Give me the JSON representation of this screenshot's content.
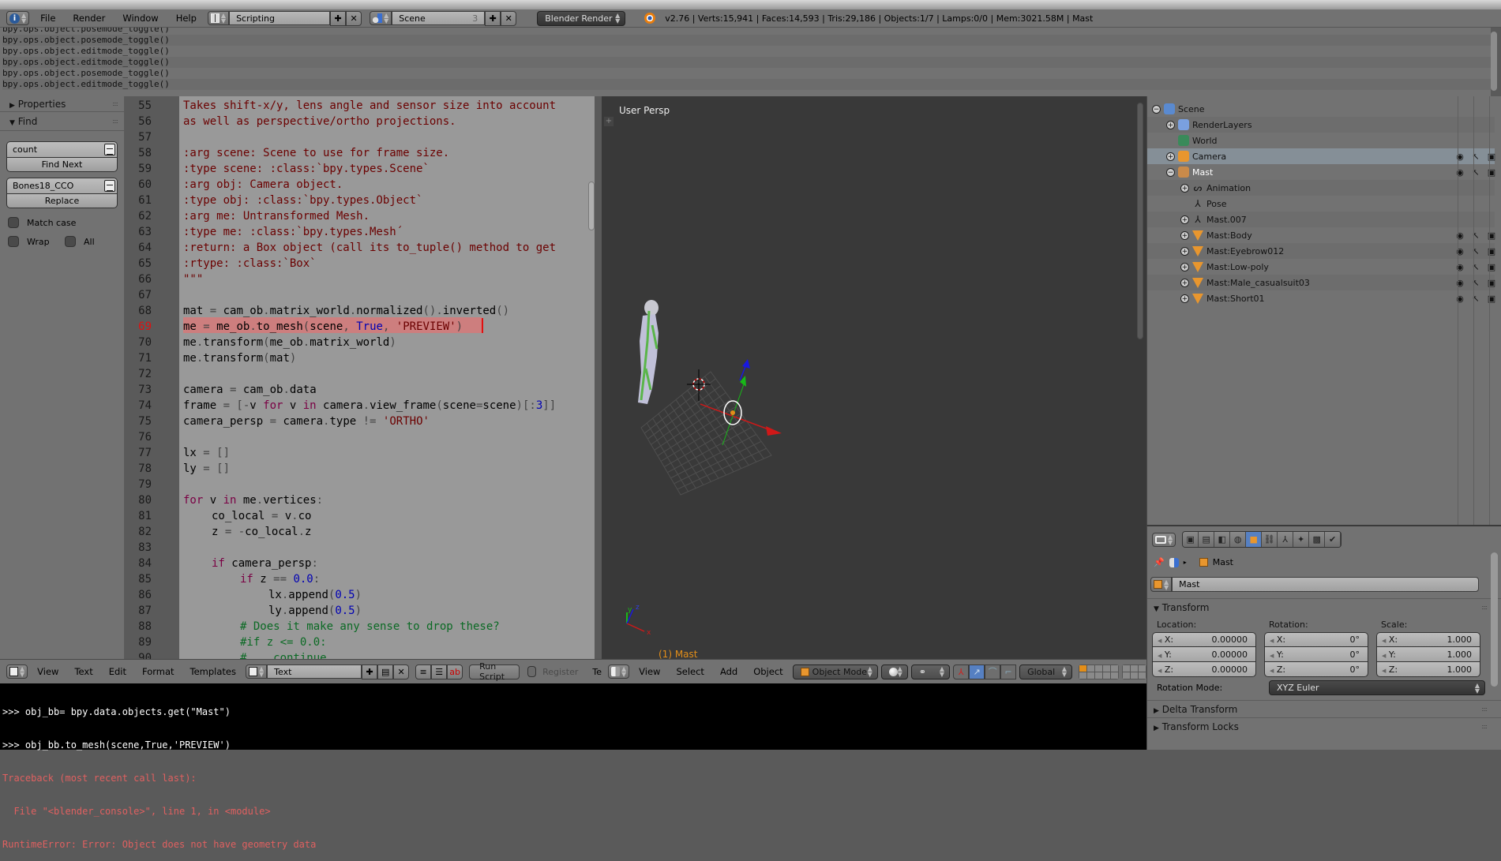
{
  "topbar": {
    "menus": [
      "File",
      "Render",
      "Window",
      "Help"
    ],
    "screen_layout": "Scripting",
    "scene": "Scene",
    "scene_users": "3",
    "render_engine": "Blender Render",
    "stats": "v2.76 | Verts:15,941 | Faces:14,593 | Tris:29,186 | Objects:1/7 | Lamps:0/0 | Mem:3021.58M | Mast"
  },
  "info_log": [
    "bpy.ops.object.posemode_toggle()",
    "bpy.ops.object.posemode_toggle()",
    "bpy.ops.object.editmode_toggle()",
    "bpy.ops.object.editmode_toggle()",
    "bpy.ops.object.posemode_toggle()",
    "bpy.ops.object.editmode_toggle()"
  ],
  "tools": {
    "properties_label": "Properties",
    "find_label": "Find",
    "find_value": "count",
    "find_next_label": "Find Next",
    "replace_value": "Bones18_CCO",
    "replace_label": "Replace",
    "match_case_label": "Match case",
    "wrap_label": "Wrap",
    "all_label": "All"
  },
  "editor": {
    "current_line": 69,
    "lines": [
      {
        "n": "55",
        "indent": 0,
        "parts": [
          [
            "str",
            "Takes shift-x/y, lens angle and sensor size into account"
          ]
        ]
      },
      {
        "n": "56",
        "indent": 0,
        "parts": [
          [
            "str",
            "as well as perspective/ortho projections."
          ]
        ]
      },
      {
        "n": "57",
        "indent": 0,
        "parts": []
      },
      {
        "n": "58",
        "indent": 0,
        "parts": [
          [
            "str",
            ":arg scene: Scene to use for frame size."
          ]
        ]
      },
      {
        "n": "59",
        "indent": 0,
        "parts": [
          [
            "str",
            ":type scene: :class:`bpy.types.Scene`"
          ]
        ]
      },
      {
        "n": "60",
        "indent": 0,
        "parts": [
          [
            "str",
            ":arg obj: Camera object."
          ]
        ]
      },
      {
        "n": "61",
        "indent": 0,
        "parts": [
          [
            "str",
            ":type obj: :class:`bpy.types.Object`"
          ]
        ]
      },
      {
        "n": "62",
        "indent": 0,
        "parts": [
          [
            "str",
            ":arg me: Untransformed Mesh."
          ]
        ]
      },
      {
        "n": "63",
        "indent": 0,
        "parts": [
          [
            "str",
            ":type me: :class:`bpy.types.Mesh´"
          ]
        ]
      },
      {
        "n": "64",
        "indent": 0,
        "parts": [
          [
            "str",
            ":return: a Box object (call its to_tuple() method to get"
          ]
        ]
      },
      {
        "n": "65",
        "indent": 0,
        "parts": [
          [
            "str",
            ":rtype: :class:`Box`"
          ]
        ]
      },
      {
        "n": "66",
        "indent": 0,
        "parts": [
          [
            "str",
            "\"\"\""
          ]
        ]
      },
      {
        "n": "67",
        "indent": 0,
        "parts": []
      },
      {
        "n": "68",
        "indent": 0,
        "parts": [
          [
            "",
            "mat "
          ],
          [
            "op",
            "="
          ],
          [
            "",
            " cam_ob"
          ],
          [
            "op",
            "."
          ],
          [
            "",
            "matrix_world"
          ],
          [
            "op",
            "."
          ],
          [
            "",
            "normalized"
          ],
          [
            "op",
            "()."
          ],
          [
            "",
            "inverted"
          ],
          [
            "op",
            "()"
          ]
        ]
      },
      {
        "n": "69",
        "indent": 0,
        "parts": [
          [
            "",
            "me "
          ],
          [
            "op",
            "="
          ],
          [
            "",
            " me_ob"
          ],
          [
            "op",
            "."
          ],
          [
            "",
            "to_mesh"
          ],
          [
            "op",
            "("
          ],
          [
            "",
            "scene"
          ],
          [
            "op",
            ", "
          ],
          [
            "num",
            "True"
          ],
          [
            "op",
            ", "
          ],
          [
            "str",
            "'PREVIEW'"
          ],
          [
            "op",
            ")"
          ]
        ]
      },
      {
        "n": "70",
        "indent": 0,
        "parts": [
          [
            "",
            "me"
          ],
          [
            "op",
            "."
          ],
          [
            "",
            "transform"
          ],
          [
            "op",
            "("
          ],
          [
            "",
            "me_ob"
          ],
          [
            "op",
            "."
          ],
          [
            "",
            "matrix_world"
          ],
          [
            "op",
            ")"
          ]
        ]
      },
      {
        "n": "71",
        "indent": 0,
        "parts": [
          [
            "",
            "me"
          ],
          [
            "op",
            "."
          ],
          [
            "",
            "transform"
          ],
          [
            "op",
            "("
          ],
          [
            "",
            "mat"
          ],
          [
            "op",
            ")"
          ]
        ]
      },
      {
        "n": "72",
        "indent": 0,
        "parts": []
      },
      {
        "n": "73",
        "indent": 0,
        "parts": [
          [
            "",
            "camera "
          ],
          [
            "op",
            "="
          ],
          [
            "",
            " cam_ob"
          ],
          [
            "op",
            "."
          ],
          [
            "",
            "data"
          ]
        ]
      },
      {
        "n": "74",
        "indent": 0,
        "parts": [
          [
            "",
            "frame "
          ],
          [
            "op",
            "= [-"
          ],
          [
            "",
            "v "
          ],
          [
            "kw",
            "for"
          ],
          [
            "",
            " v "
          ],
          [
            "kw",
            "in"
          ],
          [
            "",
            " camera"
          ],
          [
            "op",
            "."
          ],
          [
            "",
            "view_frame"
          ],
          [
            "op",
            "("
          ],
          [
            "",
            "scene"
          ],
          [
            "op",
            "="
          ],
          [
            "",
            "scene"
          ],
          [
            "op",
            ")[:"
          ],
          [
            "num",
            "3"
          ],
          [
            "op",
            "]]"
          ]
        ]
      },
      {
        "n": "75",
        "indent": 0,
        "parts": [
          [
            "",
            "camera_persp "
          ],
          [
            "op",
            "="
          ],
          [
            "",
            " camera"
          ],
          [
            "op",
            "."
          ],
          [
            "",
            "type "
          ],
          [
            "op",
            "!="
          ],
          [
            "",
            " "
          ],
          [
            "str",
            "'ORTHO'"
          ]
        ]
      },
      {
        "n": "76",
        "indent": 0,
        "parts": []
      },
      {
        "n": "77",
        "indent": 0,
        "parts": [
          [
            "",
            "lx "
          ],
          [
            "op",
            "= []"
          ]
        ]
      },
      {
        "n": "78",
        "indent": 0,
        "parts": [
          [
            "",
            "ly "
          ],
          [
            "op",
            "= []"
          ]
        ]
      },
      {
        "n": "79",
        "indent": 0,
        "parts": []
      },
      {
        "n": "80",
        "indent": 0,
        "parts": [
          [
            "kw",
            "for"
          ],
          [
            "",
            " v "
          ],
          [
            "kw",
            "in"
          ],
          [
            "",
            " me"
          ],
          [
            "op",
            "."
          ],
          [
            "",
            "vertices"
          ],
          [
            "op",
            ":"
          ]
        ]
      },
      {
        "n": "81",
        "indent": 1,
        "parts": [
          [
            "",
            "co_local "
          ],
          [
            "op",
            "="
          ],
          [
            "",
            " v"
          ],
          [
            "op",
            "."
          ],
          [
            "",
            "co"
          ]
        ]
      },
      {
        "n": "82",
        "indent": 1,
        "parts": [
          [
            "",
            "z "
          ],
          [
            "op",
            "= -"
          ],
          [
            "",
            "co_local"
          ],
          [
            "op",
            "."
          ],
          [
            "",
            "z"
          ]
        ]
      },
      {
        "n": "83",
        "indent": 0,
        "parts": []
      },
      {
        "n": "84",
        "indent": 1,
        "parts": [
          [
            "kw",
            "if"
          ],
          [
            "",
            " camera_persp"
          ],
          [
            "op",
            ":"
          ]
        ]
      },
      {
        "n": "85",
        "indent": 2,
        "parts": [
          [
            "kw",
            "if"
          ],
          [
            "",
            " z "
          ],
          [
            "op",
            "=="
          ],
          [
            "",
            " "
          ],
          [
            "num",
            "0.0"
          ],
          [
            "op",
            ":"
          ]
        ]
      },
      {
        "n": "86",
        "indent": 3,
        "parts": [
          [
            "",
            "lx"
          ],
          [
            "op",
            "."
          ],
          [
            "",
            "append"
          ],
          [
            "op",
            "("
          ],
          [
            "num",
            "0.5"
          ],
          [
            "op",
            ")"
          ]
        ]
      },
      {
        "n": "87",
        "indent": 3,
        "parts": [
          [
            "",
            "ly"
          ],
          [
            "op",
            "."
          ],
          [
            "",
            "append"
          ],
          [
            "op",
            "("
          ],
          [
            "num",
            "0.5"
          ],
          [
            "op",
            ")"
          ]
        ]
      },
      {
        "n": "88",
        "indent": 2,
        "parts": [
          [
            "com",
            "# Does it make any sense to drop these?"
          ]
        ]
      },
      {
        "n": "89",
        "indent": 2,
        "parts": [
          [
            "com",
            "#if z <= 0.0:"
          ]
        ]
      },
      {
        "n": "90",
        "indent": 2,
        "parts": [
          [
            "com",
            "#    continue"
          ]
        ]
      }
    ]
  },
  "text_header": {
    "menus": [
      "View",
      "Text",
      "Edit",
      "Format",
      "Templates"
    ],
    "datablock": "Text",
    "run_script_label": "Run Script",
    "register_label": "Register",
    "truncated_label": "Te"
  },
  "viewport": {
    "view_label": "User Persp",
    "object_label": "(1) Mast",
    "axis_labels": {
      "x": "x",
      "y": "y",
      "z": "z"
    },
    "colors": {
      "bg": "#393939",
      "x_axis": "#d01818",
      "y_axis": "#18b818",
      "z_axis": "#1818e0",
      "active_text": "#e38e19"
    }
  },
  "view_header": {
    "menus": [
      "View",
      "Select",
      "Add",
      "Object"
    ],
    "mode": "Object Mode",
    "orientation": "Global"
  },
  "console": [
    {
      "type": "in",
      "text": ">>> obj_bb= bpy.data.objects.get(\"Mast\")"
    },
    {
      "type": "in",
      "text": ">>> obj_bb.to_mesh(scene,True,'PREVIEW')"
    },
    {
      "type": "err",
      "text": "Traceback (most recent call last):"
    },
    {
      "type": "err",
      "text": "  File \"<blender_console>\", line 1, in <module>"
    },
    {
      "type": "err",
      "text": "RuntimeError: Error: Object does not have geometry data"
    }
  ],
  "outliner": {
    "rows": [
      {
        "label": "Scene",
        "depth": 0,
        "icon": "scene-icon",
        "expand": "collapse",
        "restrict": false
      },
      {
        "label": "RenderLayers",
        "depth": 1,
        "icon": "render-layers-icon",
        "expand": "expand",
        "restrict": false
      },
      {
        "label": "World",
        "depth": 1,
        "icon": "world-icon",
        "expand": "",
        "restrict": false
      },
      {
        "label": "Camera",
        "depth": 1,
        "icon": "camera-icon",
        "expand": "expand",
        "restrict": true,
        "selected": true
      },
      {
        "label": "Mast",
        "depth": 1,
        "icon": "armature-icon",
        "expand": "collapse",
        "restrict": true,
        "active": true
      },
      {
        "label": "Animation",
        "depth": 2,
        "icon": "animation-icon",
        "expand": "expand",
        "restrict": false
      },
      {
        "label": "Pose",
        "depth": 2,
        "icon": "pose-icon",
        "expand": "",
        "restrict": false
      },
      {
        "label": "Mast.007",
        "depth": 2,
        "icon": "armature-data-icon",
        "expand": "expand",
        "restrict": false
      },
      {
        "label": "Mast:Body",
        "depth": 2,
        "icon": "mesh-icon",
        "expand": "expand",
        "restrict": true
      },
      {
        "label": "Mast:Eyebrow012",
        "depth": 2,
        "icon": "mesh-icon",
        "expand": "expand",
        "restrict": true
      },
      {
        "label": "Mast:Low-poly",
        "depth": 2,
        "icon": "mesh-icon",
        "expand": "expand",
        "restrict": true
      },
      {
        "label": "Mast:Male_casualsuit03",
        "depth": 2,
        "icon": "mesh-icon",
        "expand": "expand",
        "restrict": true
      },
      {
        "label": "Mast:Short01",
        "depth": 2,
        "icon": "mesh-icon",
        "expand": "expand",
        "restrict": true
      }
    ]
  },
  "properties": {
    "tabs": [
      "render",
      "render-layers",
      "scene",
      "world",
      "object",
      "constraints",
      "data",
      "bone",
      "material",
      "physics"
    ],
    "active_tab": "object",
    "breadcrumb": "Mast",
    "object_name": "Mast",
    "transform_label": "Transform",
    "location_label": "Location:",
    "rotation_label": "Rotation:",
    "scale_label": "Scale:",
    "location": [
      {
        "axis": "X:",
        "value": "0.00000"
      },
      {
        "axis": "Y:",
        "value": "0.00000"
      },
      {
        "axis": "Z:",
        "value": "0.00000"
      }
    ],
    "rotation": [
      {
        "axis": "X:",
        "value": "0°"
      },
      {
        "axis": "Y:",
        "value": "0°"
      },
      {
        "axis": "Z:",
        "value": "0°"
      }
    ],
    "scale": [
      {
        "axis": "X:",
        "value": "1.000"
      },
      {
        "axis": "Y:",
        "value": "1.000"
      },
      {
        "axis": "Z:",
        "value": "1.000"
      }
    ],
    "rotation_mode_label": "Rotation Mode:",
    "rotation_mode": "XYZ Euler",
    "delta_transform_label": "Delta Transform",
    "transform_locks_label": "Transform Locks"
  }
}
